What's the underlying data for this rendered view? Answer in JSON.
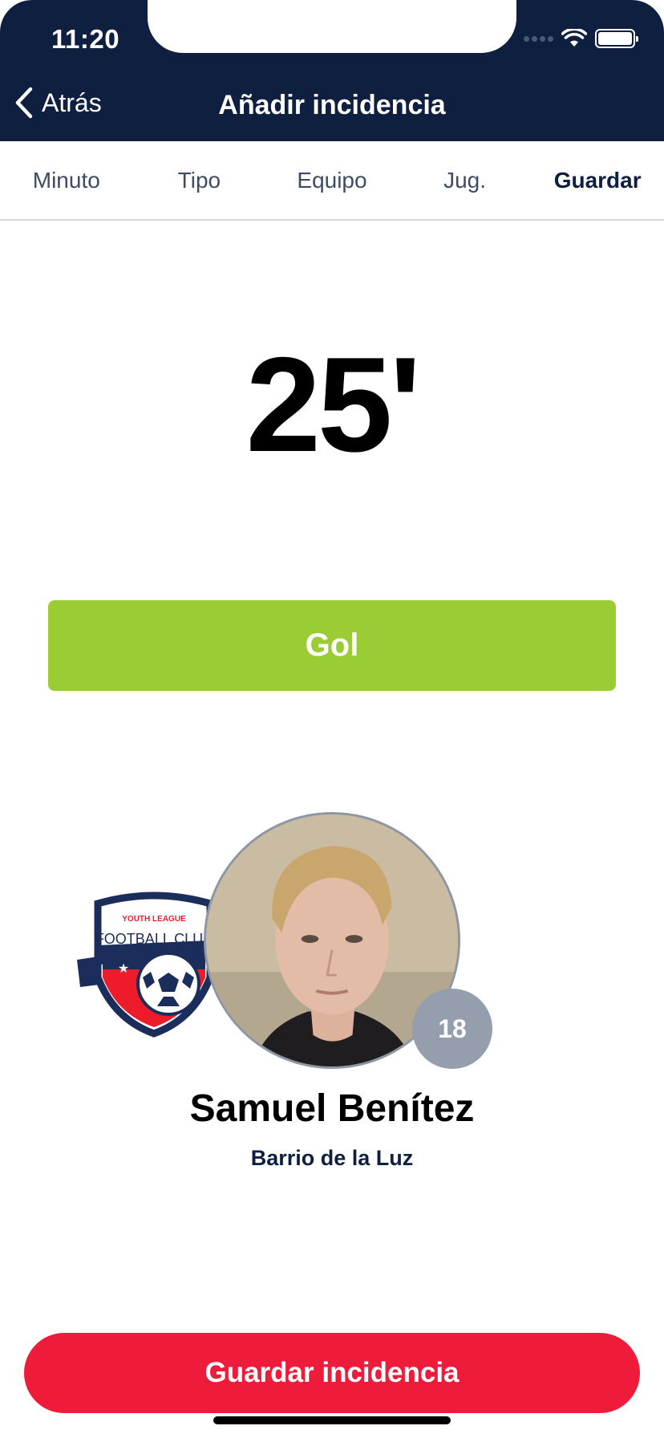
{
  "status_bar": {
    "time": "11:20"
  },
  "nav": {
    "back_label": "Atrás",
    "title": "Añadir incidencia"
  },
  "steps": [
    {
      "label": "Minuto"
    },
    {
      "label": "Tipo"
    },
    {
      "label": "Equipo"
    },
    {
      "label": "Jug."
    },
    {
      "label": "Guardar",
      "active": true
    }
  ],
  "incident": {
    "minute": "25'",
    "type_label": "Gol",
    "type_color": "#9acd34"
  },
  "player": {
    "name": "Samuel Benítez",
    "team": "Barrio de la Luz",
    "number": "18"
  },
  "team_crest": {
    "top_text": "YOUTH LEAGUE",
    "main_text": "FOOTBALL CLUB"
  },
  "actions": {
    "save_label": "Guardar incidencia",
    "save_color": "#ef1b3a"
  },
  "theme": {
    "header_bg": "#0f1f40"
  }
}
